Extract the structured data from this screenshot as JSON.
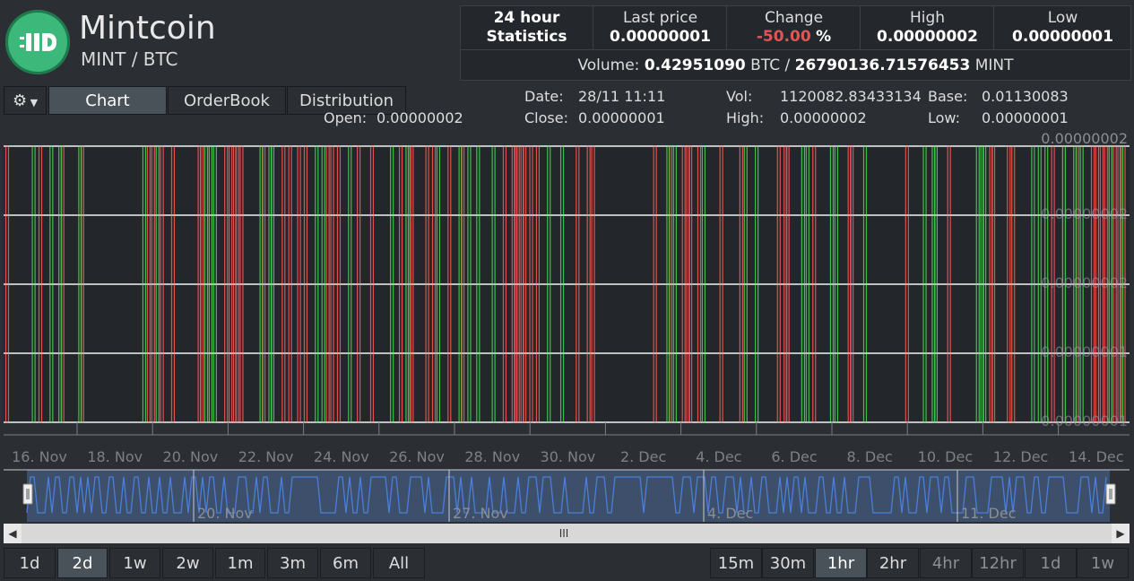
{
  "header": {
    "coin_name": "Mintcoin",
    "pair": "MINT / BTC",
    "logo_icon": "mintcoin-logo-icon"
  },
  "stats": {
    "title_line1": "24 hour",
    "title_line2": "Statistics",
    "last_price_label": "Last price",
    "last_price": "0.00000001",
    "change_label": "Change",
    "change_value": "-50.00",
    "change_unit": "%",
    "high_label": "High",
    "high_value": "0.00000002",
    "low_label": "Low",
    "low_value": "0.00000001",
    "volume_label": "Volume:",
    "volume_btc": "0.42951090",
    "volume_btc_unit": "BTC /",
    "volume_mint": "26790136.71576453",
    "volume_mint_unit": "MINT"
  },
  "tabs": {
    "settings_icon": "gear-icon",
    "chart": "Chart",
    "orderbook": "OrderBook",
    "distribution": "Distribution"
  },
  "info": {
    "open_label": "Open:",
    "open_value": "0.00000002",
    "date_label": "Date:",
    "date_value": "28/11 11:11",
    "close_label": "Close:",
    "close_value": "0.00000001",
    "vol_label": "Vol:",
    "vol_value": "1120082.83433134",
    "high_label": "High:",
    "high_value": "0.00000002",
    "base_label": "Base:",
    "base_value": "0.01130083",
    "low_label": "Low:",
    "low_value": "0.00000001"
  },
  "colors": {
    "up": "#3fbf4a",
    "down": "#e0504f",
    "grid": "#e6e6e6",
    "navigator_line": "#4a7fd8",
    "navigator_fill": "#3d4f6b"
  },
  "chart_data": {
    "type": "bar",
    "title": "",
    "y_tick_labels": [
      "0.00000002",
      "0.00000002",
      "0.00000002",
      "0.00000001",
      "0.00000001"
    ],
    "x_tick_labels": [
      "16. Nov",
      "18. Nov",
      "20. Nov",
      "22. Nov",
      "24. Nov",
      "26. Nov",
      "28. Nov",
      "30. Nov",
      "2. Dec",
      "4. Dec",
      "6. Dec",
      "8. Dec",
      "10. Dec",
      "12. Dec",
      "14. Dec"
    ],
    "ylim": [
      1e-08,
      2e-08
    ],
    "grid": true,
    "candles_up_days": [
      1.2,
      2.0,
      2.4,
      3.3,
      6.2,
      6.8,
      9.0,
      9.2,
      9.4,
      11.5,
      11.9,
      12.0,
      14.0,
      14.3,
      15.5,
      17.4,
      18.1,
      19.5,
      20.5,
      20.9,
      21.3,
      22.0,
      24.5,
      25.1,
      29.9,
      30.2,
      31.5,
      33.4,
      33.9,
      36.0,
      36.2,
      37.3,
      37.5,
      38.8,
      41.5,
      41.9,
      42.0,
      43.9,
      44.1,
      44.2,
      46.4,
      46.7,
      47.0,
      47.8,
      48.3,
      48.6,
      49.9,
      50.4
    ],
    "candles_down_days": [
      0.0,
      1.5,
      2.5,
      3.4,
      6.4,
      6.6,
      7.0,
      7.5,
      8.7,
      8.8,
      9.2,
      9.9,
      10.1,
      10.3,
      10.4,
      10.6,
      11.6,
      12.5,
      12.8,
      13.2,
      13.5,
      14.5,
      14.7,
      15.0,
      15.9,
      16.5,
      17.8,
      18.2,
      18.3,
      19.0,
      19.3,
      20.0,
      20.6,
      22.5,
      22.9,
      23.0,
      23.1,
      23.3,
      23.4,
      23.7,
      24.0,
      25.8,
      26.3,
      26.5,
      29.3,
      30.0,
      30.6,
      30.8,
      30.9,
      31.3,
      32.3,
      33.2,
      34.9,
      35.2,
      35.3,
      36.5,
      38.1,
      38.2,
      40.7,
      42.6,
      44.5,
      44.6,
      45.3,
      45.5,
      47.3,
      47.8,
      48.4,
      49.1,
      49.3,
      49.5,
      49.7,
      49.9,
      50.1,
      50.3,
      50.5
    ]
  },
  "navigator": {
    "labels": [
      "20. Nov",
      "27. Nov",
      "4. Dec",
      "11. Dec"
    ]
  },
  "scrollbar": {
    "left_arrow": "◀",
    "right_arrow": "▶",
    "grip": "III"
  },
  "ranges_left": [
    "1d",
    "2d",
    "1w",
    "2w",
    "1m",
    "3m",
    "6m",
    "All"
  ],
  "ranges_right": [
    "15m",
    "30m",
    "1hr",
    "2hr",
    "4hr",
    "12hr",
    "1d",
    "1w"
  ],
  "active_range_left": "2d",
  "active_range_right": "1hr"
}
